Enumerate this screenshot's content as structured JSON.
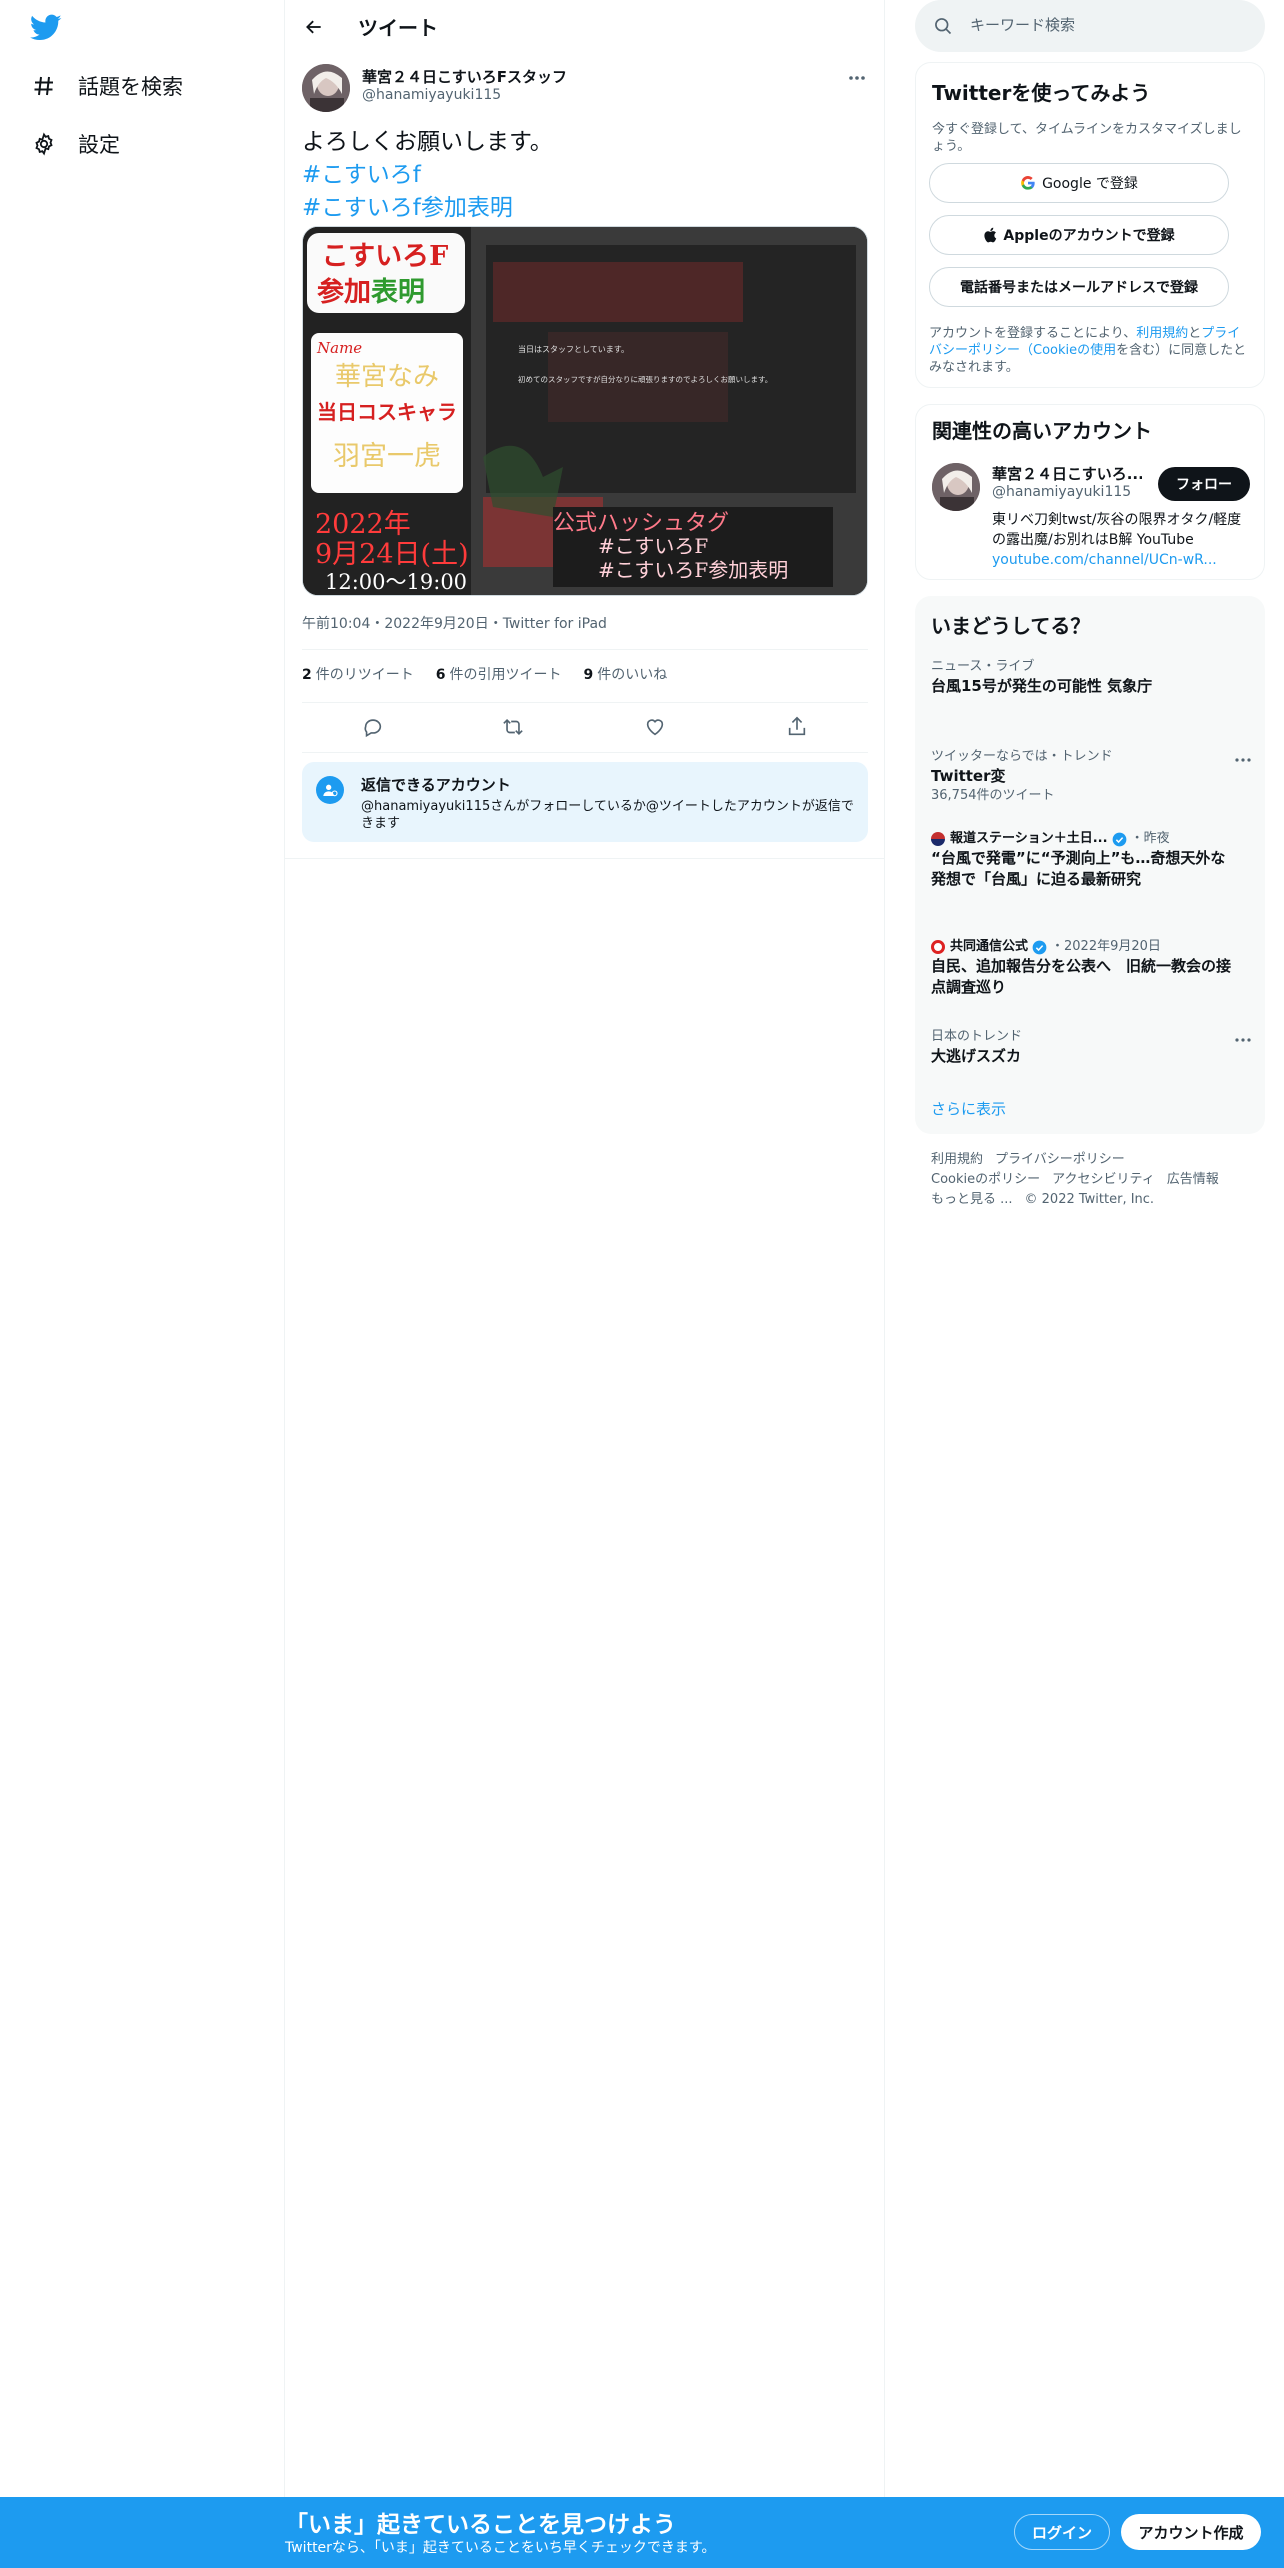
{
  "nav": {
    "items": [
      {
        "label": "話題を検索",
        "icon": "hashtag-icon"
      },
      {
        "label": "設定",
        "icon": "gear-icon"
      }
    ]
  },
  "header": {
    "title": "ツイート"
  },
  "tweet": {
    "display_name": "華宮２４日こすいろFスタッフ",
    "handle": "@hanamiyayuki115",
    "text_line1": "よろしくお願いします。",
    "hashtag1": "#こすいろf",
    "hashtag2": "#こすいろf参加表明",
    "meta": "午前10:04・2022年9月20日・Twitter for iPad",
    "stats": {
      "retweets_count": "2",
      "retweets_label": "件のリツイート",
      "quotes_count": "6",
      "quotes_label": "件の引用ツイート",
      "likes_count": "9",
      "likes_label": "件のいいね"
    },
    "media": {
      "title_line1": "こすいろF",
      "title_line2_a": "参加",
      "title_line2_b": "表明",
      "name_label": "Name",
      "name": "華宮なみ",
      "cos_label": "当日コスキャラ",
      "character": "羽宮一虎",
      "date_line1": "2022年",
      "date_line2": "9月24日(土)",
      "time": "12:00〜19:00",
      "note_line1": "当日はスタッフとしています。",
      "note_line2": "初めてのスタッフですが自分なりに頑張りますのでよろしくお願いします。",
      "tag_title": "公式ハッシュタグ",
      "tag1": "#こすいろF",
      "tag2": "#こすいろF参加表明"
    },
    "reply": {
      "title": "返信できるアカウント",
      "desc": "@hanamiyayuki115さんがフォローしているか@ツイートしたアカウントが返信できます"
    }
  },
  "search": {
    "placeholder": "キーワード検索"
  },
  "signup": {
    "title": "Twitterを使ってみよう",
    "desc": "今すぐ登録して、タイムラインをカスタマイズしましょう。",
    "google": "Google で登録",
    "apple": "Appleのアカウントで登録",
    "phone": "電話番号またはメールアドレスで登録",
    "terms_pre": "アカウントを登録することにより、",
    "terms_link1": "利用規約",
    "terms_mid": "と",
    "terms_link2": "プライバシーポリシー（Cookieの使用",
    "terms_post": "を含む）に同意したとみなされます。"
  },
  "related": {
    "title": "関連性の高いアカウント",
    "name": "華宮２４日こすいろ...",
    "handle": "@hanamiyayuki115",
    "follow": "フォロー",
    "bio": "東リベ刀剣twst/灰谷の限界オタク/軽度の露出魔/お別れはB解 YouTube",
    "link": "youtube.com/channel/UCn-wR..."
  },
  "trends": {
    "title": "いまどうしてる？",
    "items": [
      {
        "meta": "ニュース・ライブ",
        "title": "台風15号が発生の可能性 気象庁"
      },
      {
        "meta": "ツイッターならでは・トレンド",
        "title": "Twitter変",
        "count": "36,754件のツイート"
      },
      {
        "source": "報道ステーション＋土日...",
        "time": "・昨夜",
        "title": "“台風で発電”に“予測向上”も…奇想天外な発想で「台風」に迫る最新研究"
      },
      {
        "source": "共同通信公式",
        "time": "・2022年9月20日",
        "title": "自民、追加報告分を公表へ　旧統一教会の接点調査巡り"
      },
      {
        "meta": "日本のトレンド",
        "title": "大逃げスズカ"
      }
    ],
    "show_more": "さらに表示"
  },
  "footer": {
    "terms": "利用規約",
    "privacy": "プライバシーポリシー",
    "cookie": "Cookieのポリシー",
    "accessibility": "アクセシビリティ",
    "ads": "広告情報",
    "more": "もっと見る ...",
    "copyright": "© 2022 Twitter, Inc."
  },
  "bottom_bar": {
    "title": "「いま」起きていることを見つけよう",
    "subtitle": "Twitterなら、「いま」起きていることをいち早くチェックできます。",
    "login": "ログイン",
    "signup": "アカウント作成"
  },
  "colors": {
    "accent": "#1d9bf0",
    "text": "#0f1419",
    "muted": "#536471"
  }
}
